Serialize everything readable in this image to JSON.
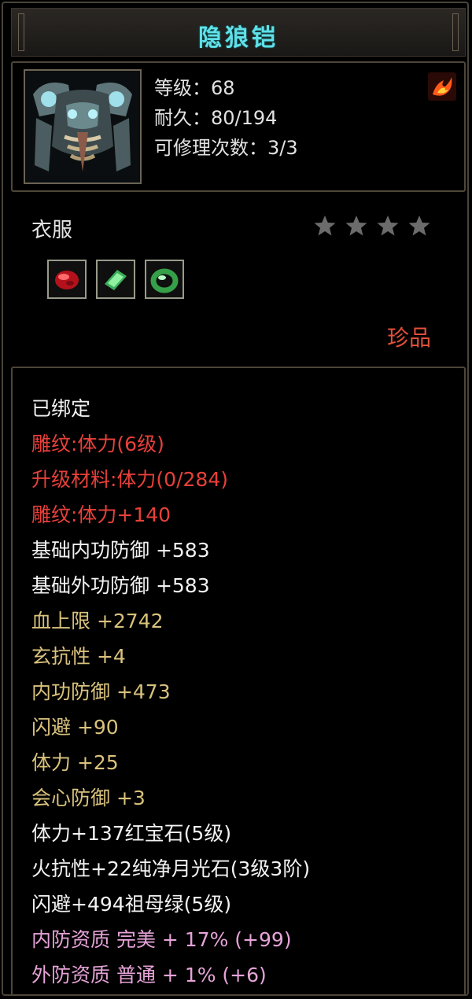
{
  "item": {
    "name": "隐狼铠",
    "stats": [
      "等级：68",
      "耐久：80/194",
      "可修理次数：3/3"
    ],
    "type": "衣服",
    "stars_total": 4,
    "stars_filled": 0,
    "rarity": "珍品",
    "gems": [
      "red-gem-icon",
      "green-gem-icon",
      "green-ring-icon"
    ]
  },
  "attributes": [
    {
      "text": "已绑定",
      "color": "#f2f2f2"
    },
    {
      "text": "雕纹:体力(6级)",
      "color": "#e8403a"
    },
    {
      "text": "升级材料:体力(0/284)",
      "color": "#e8403a"
    },
    {
      "text": "雕纹:体力+140",
      "color": "#e8403a"
    },
    {
      "text": "基础内功防御 +583",
      "color": "#f2f2f2"
    },
    {
      "text": "基础外功防御 +583",
      "color": "#f2f2f2"
    },
    {
      "text": "血上限 +2742",
      "color": "#d9c27c"
    },
    {
      "text": "玄抗性 +4",
      "color": "#d9c27c"
    },
    {
      "text": "内功防御 +473",
      "color": "#d9c27c"
    },
    {
      "text": "闪避 +90",
      "color": "#d9c27c"
    },
    {
      "text": "体力 +25",
      "color": "#d9c27c"
    },
    {
      "text": "会心防御 +3",
      "color": "#d9c27c"
    },
    {
      "text": "体力+137红宝石(5级)",
      "color": "#f2f2f2"
    },
    {
      "text": "火抗性+22纯净月光石(3级3阶)",
      "color": "#f2f2f2"
    },
    {
      "text": "闪避+494祖母绿(5级)",
      "color": "#f2f2f2"
    },
    {
      "text": "内防资质 完美 + 17% (+99)",
      "color": "#e6a3d8"
    },
    {
      "text": "外防资质 普通 + 1% (+6)",
      "color": "#e6a3d8"
    }
  ]
}
